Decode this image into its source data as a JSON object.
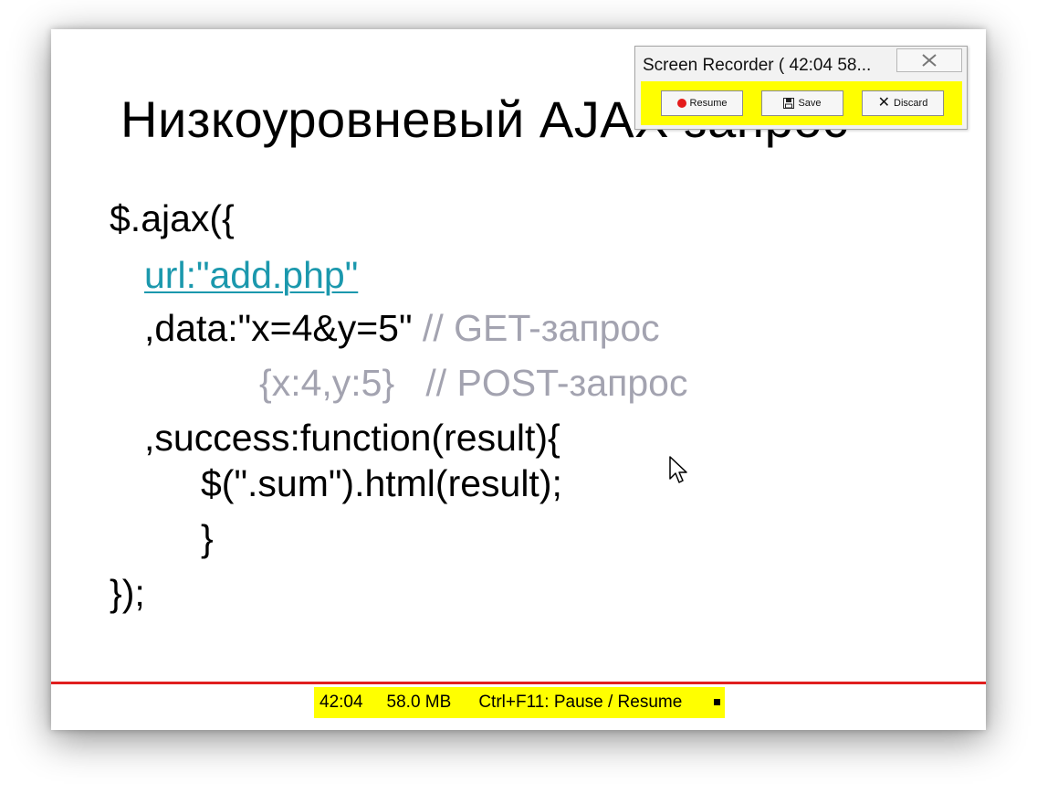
{
  "slide": {
    "title": "Низкоуровневый AJAX запрос",
    "code": {
      "line1": "$.ajax({",
      "line2_url": "url:\"add.php\"",
      "line3_code": ",data:\"x=4&y=5\"",
      "line3_comment": " // GET-запрос",
      "line4_code": "{x:4,y:5}",
      "line4_comment": "   // POST-запрос",
      "line5": ",success:function(result){",
      "line6": "$(\".sum\").html(result);",
      "line7": "}",
      "line8": "});"
    }
  },
  "recorder": {
    "title": "Screen Recorder ( 42:04   58...",
    "buttons": {
      "resume": "Resume",
      "save": "Save",
      "discard": "Discard"
    }
  },
  "status_bar": {
    "time": "42:04",
    "size": "58.0 MB",
    "hint": "Ctrl+F11: Pause / Resume"
  },
  "colors": {
    "link": "#1b98ad",
    "comment": "#a3a3b0",
    "highlight": "#ffff00",
    "red_line": "#e01e1e",
    "record_dot": "#e41b1b"
  },
  "icons": {
    "close": "close-icon",
    "record": "record-dot-icon",
    "save": "floppy-disk-icon",
    "discard": "x-icon",
    "stop": "stop-square-icon",
    "cursor": "mouse-cursor-icon"
  }
}
